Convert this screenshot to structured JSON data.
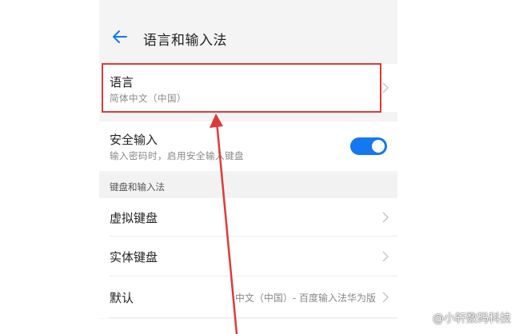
{
  "header": {
    "title": "语言和输入法"
  },
  "language_row": {
    "title": "语言",
    "subtitle": "简体中文（中国）"
  },
  "secure_input_row": {
    "title": "安全输入",
    "subtitle": "输入密码时，启用安全输入键盘",
    "toggle_on": true
  },
  "keyboard_section": {
    "header": "键盘和输入法",
    "items": [
      {
        "label": "虚拟键盘"
      },
      {
        "label": "实体键盘"
      },
      {
        "label": "默认",
        "value": "中文（中国）- 百度输入法华为版"
      }
    ]
  },
  "watermark": {
    "text": "@小轩数码科技"
  },
  "colors": {
    "accent": "#1478f0",
    "highlight": "#e0393a"
  }
}
